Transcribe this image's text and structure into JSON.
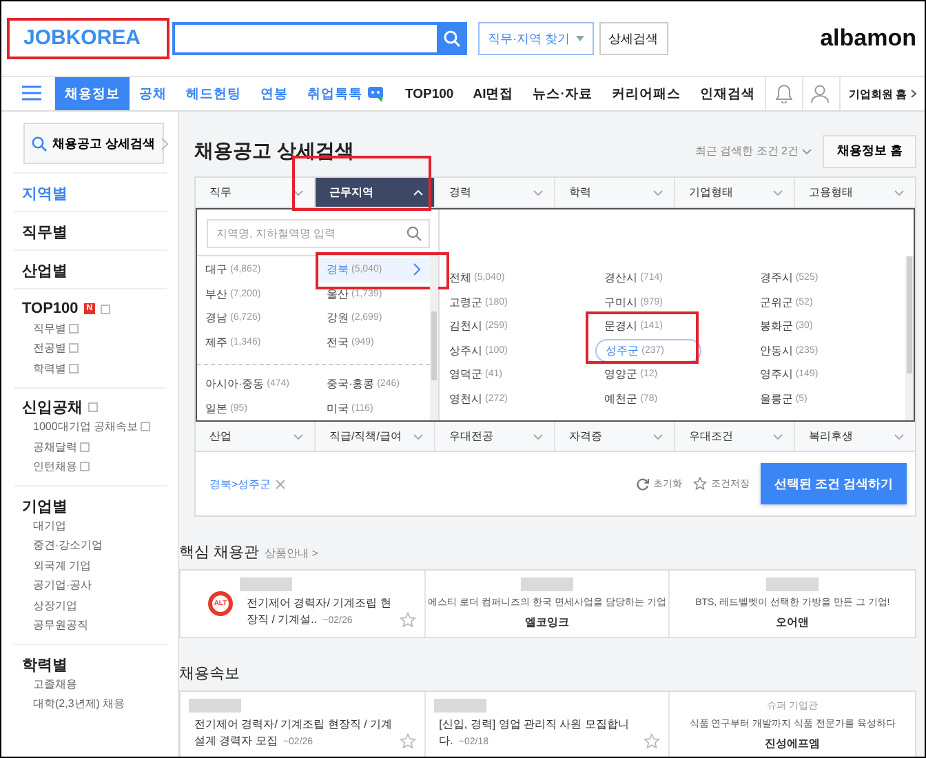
{
  "header": {
    "logo": {
      "text": "JOBKOREA",
      "annotated": true
    },
    "buttons": [
      {
        "label": "직무·지역 찾기",
        "kind": "dropdown"
      },
      {
        "label": "상세검색",
        "kind": "plain"
      }
    ],
    "partner_logo": "albamon"
  },
  "nav": {
    "items": [
      {
        "label": "채용정보",
        "selected": true,
        "kind": "primary"
      },
      {
        "label": "공채",
        "selected": false,
        "kind": "primary",
        "icon": false
      },
      {
        "label": "헤드헌팅",
        "selected": false,
        "kind": "primary"
      },
      {
        "label": "연봉",
        "selected": false,
        "kind": "primary"
      },
      {
        "label": "취업톡톡",
        "selected": false,
        "kind": "primary",
        "icon": true
      },
      {
        "label": "TOP100",
        "selected": false,
        "kind": "secondary"
      },
      {
        "label": "AI면접",
        "selected": false,
        "kind": "secondary"
      },
      {
        "label": "뉴스·자료",
        "selected": false,
        "kind": "secondary"
      },
      {
        "label": "커리어패스",
        "selected": false,
        "kind": "secondary"
      },
      {
        "label": "인재검색",
        "selected": false,
        "kind": "secondary"
      }
    ],
    "corporate_link": "기업회원 홈"
  },
  "sidebar": {
    "search_button": "채용공고 상세검색",
    "groups": [
      {
        "title": "지역별",
        "selected": true
      },
      {
        "title": "직무별",
        "selected": false
      },
      {
        "title": "산업별",
        "selected": false
      },
      {
        "title": "TOP100",
        "selected": false,
        "badge": "N",
        "external": true,
        "items": [
          {
            "label": "직무별",
            "external": true
          },
          {
            "label": "전공별",
            "external": true
          },
          {
            "label": "학력별",
            "external": true
          }
        ]
      },
      {
        "title": "신입공채",
        "selected": false,
        "external": true,
        "items": [
          {
            "label": "1000대기업 공채속보",
            "external": true
          },
          {
            "label": "공채달력",
            "external": true
          },
          {
            "label": "인턴채용",
            "external": true
          }
        ]
      },
      {
        "title": "기업별",
        "selected": false,
        "items": [
          {
            "label": "대기업",
            "external": false
          },
          {
            "label": "중견·강소기업",
            "external": false
          },
          {
            "label": "외국계 기업",
            "external": false
          },
          {
            "label": "공기업·공사",
            "external": false
          },
          {
            "label": "상장기업",
            "external": false
          },
          {
            "label": "공무원공직",
            "external": false
          }
        ]
      },
      {
        "title": "학력별",
        "selected": false,
        "items": [
          {
            "label": "고졸채용",
            "external": false
          },
          {
            "label": "대학(2,3년제) 채용",
            "external": false
          }
        ]
      }
    ]
  },
  "main": {
    "title": "채용공고 상세검색",
    "recent": "최근 검색한 조건 2건",
    "home_button": "채용정보 홈",
    "filter_tabs": [
      {
        "label": "직무",
        "selected": false,
        "annotated": false
      },
      {
        "label": "근무지역",
        "selected": true,
        "annotated": true
      },
      {
        "label": "경력",
        "selected": false,
        "annotated": false
      },
      {
        "label": "학력",
        "selected": false,
        "annotated": false
      },
      {
        "label": "기업형태",
        "selected": false,
        "annotated": false
      },
      {
        "label": "고용형태",
        "selected": false,
        "annotated": false
      }
    ],
    "region_panel": {
      "search": {
        "placeholder": "지역명, 지하철역명 입력"
      },
      "domestic": [
        {
          "label": "대구",
          "count": "(4,862)",
          "selected": false,
          "annotated": false
        },
        {
          "label": "경북",
          "count": "(5,040)",
          "selected": true,
          "annotated": true
        },
        {
          "label": "부산",
          "count": "(7,200)",
          "selected": false,
          "annotated": false
        },
        {
          "label": "울산",
          "count": "(1,739)",
          "selected": false,
          "annotated": false
        },
        {
          "label": "경남",
          "count": "(6,726)",
          "selected": false,
          "annotated": false
        },
        {
          "label": "강원",
          "count": "(2,699)",
          "selected": false,
          "annotated": false
        },
        {
          "label": "제주",
          "count": "(1,346)",
          "selected": false,
          "annotated": false
        },
        {
          "label": "전국",
          "count": "(949)",
          "selected": false,
          "annotated": false
        }
      ],
      "overseas": [
        {
          "label": "아시아·중동",
          "count": "(474)",
          "selected": false,
          "annotated": false
        },
        {
          "label": "중국·홍콩",
          "count": "(246)",
          "selected": false,
          "annotated": false
        },
        {
          "label": "일본",
          "count": "(95)",
          "selected": false,
          "annotated": false
        },
        {
          "label": "미국",
          "count": "(116)",
          "selected": false,
          "annotated": false
        }
      ],
      "subregions": [
        {
          "label": "전체",
          "count": "(5,040)",
          "selected": false,
          "annotated": false
        },
        {
          "label": "경산시",
          "count": "(714)",
          "selected": false,
          "annotated": false
        },
        {
          "label": "경주시",
          "count": "(525)",
          "selected": false,
          "annotated": false
        },
        {
          "label": "고령군",
          "count": "(180)",
          "selected": false,
          "annotated": false
        },
        {
          "label": "구미시",
          "count": "(979)",
          "selected": false,
          "annotated": false
        },
        {
          "label": "군위군",
          "count": "(52)",
          "selected": false,
          "annotated": false
        },
        {
          "label": "김천시",
          "count": "(259)",
          "selected": false,
          "annotated": false
        },
        {
          "label": "문경시",
          "count": "(141)",
          "selected": false,
          "annotated": false
        },
        {
          "label": "봉화군",
          "count": "(30)",
          "selected": false,
          "annotated": false
        },
        {
          "label": "상주시",
          "count": "(100)",
          "selected": false,
          "annotated": false
        },
        {
          "label": "성주군",
          "count": "(237)",
          "selected": true,
          "annotated": true
        },
        {
          "label": "안동시",
          "count": "(235)",
          "selected": false,
          "annotated": false
        },
        {
          "label": "영덕군",
          "count": "(41)",
          "selected": false,
          "annotated": false
        },
        {
          "label": "영양군",
          "count": "(12)",
          "selected": false,
          "annotated": false
        },
        {
          "label": "영주시",
          "count": "(149)",
          "selected": false,
          "annotated": false
        },
        {
          "label": "영천시",
          "count": "(272)",
          "selected": false,
          "annotated": false
        },
        {
          "label": "예천군",
          "count": "(78)",
          "selected": false,
          "annotated": false
        },
        {
          "label": "울릉군",
          "count": "(5)",
          "selected": false,
          "annotated": false
        }
      ]
    },
    "more_filter_tabs": [
      {
        "label": "산업",
        "selected": false
      },
      {
        "label": "직급/직책/급여",
        "selected": false
      },
      {
        "label": "우대전공",
        "selected": false
      },
      {
        "label": "자격증",
        "selected": false
      },
      {
        "label": "우대조건",
        "selected": false
      },
      {
        "label": "복리후생",
        "selected": false
      }
    ],
    "selected_conditions": [
      {
        "label": "경북>성주군"
      }
    ],
    "actions": [
      {
        "label": "초기화",
        "kind": "reset"
      },
      {
        "label": "조건저장",
        "kind": "save"
      }
    ],
    "search_button": "선택된 조건 검색하기"
  },
  "featured": {
    "title": "핵심 채용관",
    "link": "상품안내 >",
    "cards": [
      {
        "kind": "job",
        "logo": "ALT",
        "title": "전기제어 경력자/ 기계조립 현장직 / 기계설..",
        "deadline": "~02/26"
      },
      {
        "kind": "company",
        "tagline": "에스티 로더 컴퍼니즈의 한국 면세사업을 담당하는 기업",
        "company": "엘코잉크"
      },
      {
        "kind": "company",
        "tagline": "BTS, 레드벨벳이 선택한 가방을 만든 그 기업!",
        "company": "오어앤"
      }
    ]
  },
  "quick": {
    "title": "채용속보",
    "cards": [
      {
        "kind": "job",
        "title": "전기제어 경력자/ 기계조립 현장직 / 기계설계 경력자 모집",
        "deadline": "~02/26"
      },
      {
        "kind": "job",
        "title": "[신입, 경력] 영업 관리직 사원 모집합니다.",
        "deadline": "~02/18"
      },
      {
        "kind": "showcase",
        "label": "슈퍼 기업관",
        "tagline": "식품 연구부터 개발까지 식품 전문가를 육성하다",
        "company": "진성에프엠"
      }
    ]
  }
}
